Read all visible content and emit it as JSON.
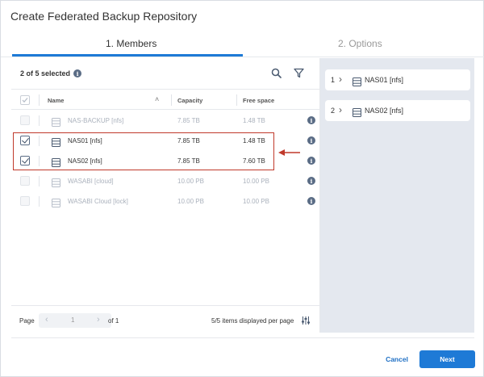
{
  "dialog": {
    "title": "Create Federated Backup Repository"
  },
  "tabs": [
    {
      "label": "1. Members",
      "active": true
    },
    {
      "label": "2. Options",
      "active": false
    }
  ],
  "members_panel": {
    "selected_count": "2 of 5 selected",
    "columns": {
      "name": "Name",
      "capacity": "Capacity",
      "free_space": "Free space"
    },
    "rows": [
      {
        "name": "NAS-BACKUP [nfs]",
        "capacity": "7.85 TB",
        "free_space": "1.48 TB",
        "checked": false,
        "enabled": false
      },
      {
        "name": "NAS01 [nfs]",
        "capacity": "7.85 TB",
        "free_space": "1.48 TB",
        "checked": true,
        "enabled": true
      },
      {
        "name": "NAS02 [nfs]",
        "capacity": "7.85 TB",
        "free_space": "7.60 TB",
        "checked": true,
        "enabled": true
      },
      {
        "name": "WASABI [cloud]",
        "capacity": "10.00 PB",
        "free_space": "10.00 PB",
        "checked": false,
        "enabled": false
      },
      {
        "name": "WASABI Cloud [lock]",
        "capacity": "10.00 PB",
        "free_space": "10.00 PB",
        "checked": false,
        "enabled": false
      }
    ],
    "pager": {
      "page_label": "Page",
      "current_page": "1",
      "of_label": "of 1",
      "per_page": "5/5 items displayed per page"
    }
  },
  "selected_members": [
    {
      "index": "1",
      "name": "NAS01 [nfs]"
    },
    {
      "index": "2",
      "name": "NAS02 [nfs]"
    }
  ],
  "footer": {
    "cancel_label": "Cancel",
    "next_label": "Next"
  },
  "colors": {
    "accent": "#1e7ad6",
    "highlight": "#c0392b",
    "right_panel_bg": "#e4e8ef"
  }
}
